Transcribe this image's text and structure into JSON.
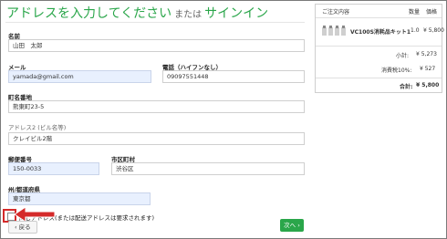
{
  "title": {
    "main": "アドレスを入力してください",
    "or": "または",
    "signin": "サインイン"
  },
  "form": {
    "name_label": "名前",
    "name_value": "山田　太郎",
    "email_label": "メール",
    "email_value": "yamada@gmail.com",
    "phone_label": "電話（ハイフンなし）",
    "phone_value": "09097551448",
    "address1_label": "町名番地",
    "address1_value": "熊東町23-5",
    "address2_label": "アドレス2 (ビル名等)",
    "address2_value": "クレイビル2階",
    "zip_label": "郵便番号",
    "zip_value": "150-0033",
    "city_label": "市区町村",
    "city_value": "渋谷区",
    "state_label": "州/都道府県",
    "state_value": "東京都",
    "same_address_text": "同じアドレス(または配送アドレスは要求されます)",
    "same_address_checked": false,
    "back_label": "戻る",
    "next_label": "次へ"
  },
  "summary": {
    "header_contents": "ご注文内容",
    "header_qty": "数量",
    "header_price": "価格",
    "item_name": "VC100S消耗品キット1",
    "item_qty": "1.0",
    "item_price": "¥ 5,800",
    "subtotal_label": "小計:",
    "subtotal_value": "¥ 5,273",
    "tax_label": "消費税10%:",
    "tax_value": "¥ 527",
    "total_label": "合計:",
    "total_value": "¥ 5,800"
  },
  "colors": {
    "accent": "#2aa64a",
    "highlight": "#d42a2a",
    "filled_input": "#e8f0fe"
  }
}
